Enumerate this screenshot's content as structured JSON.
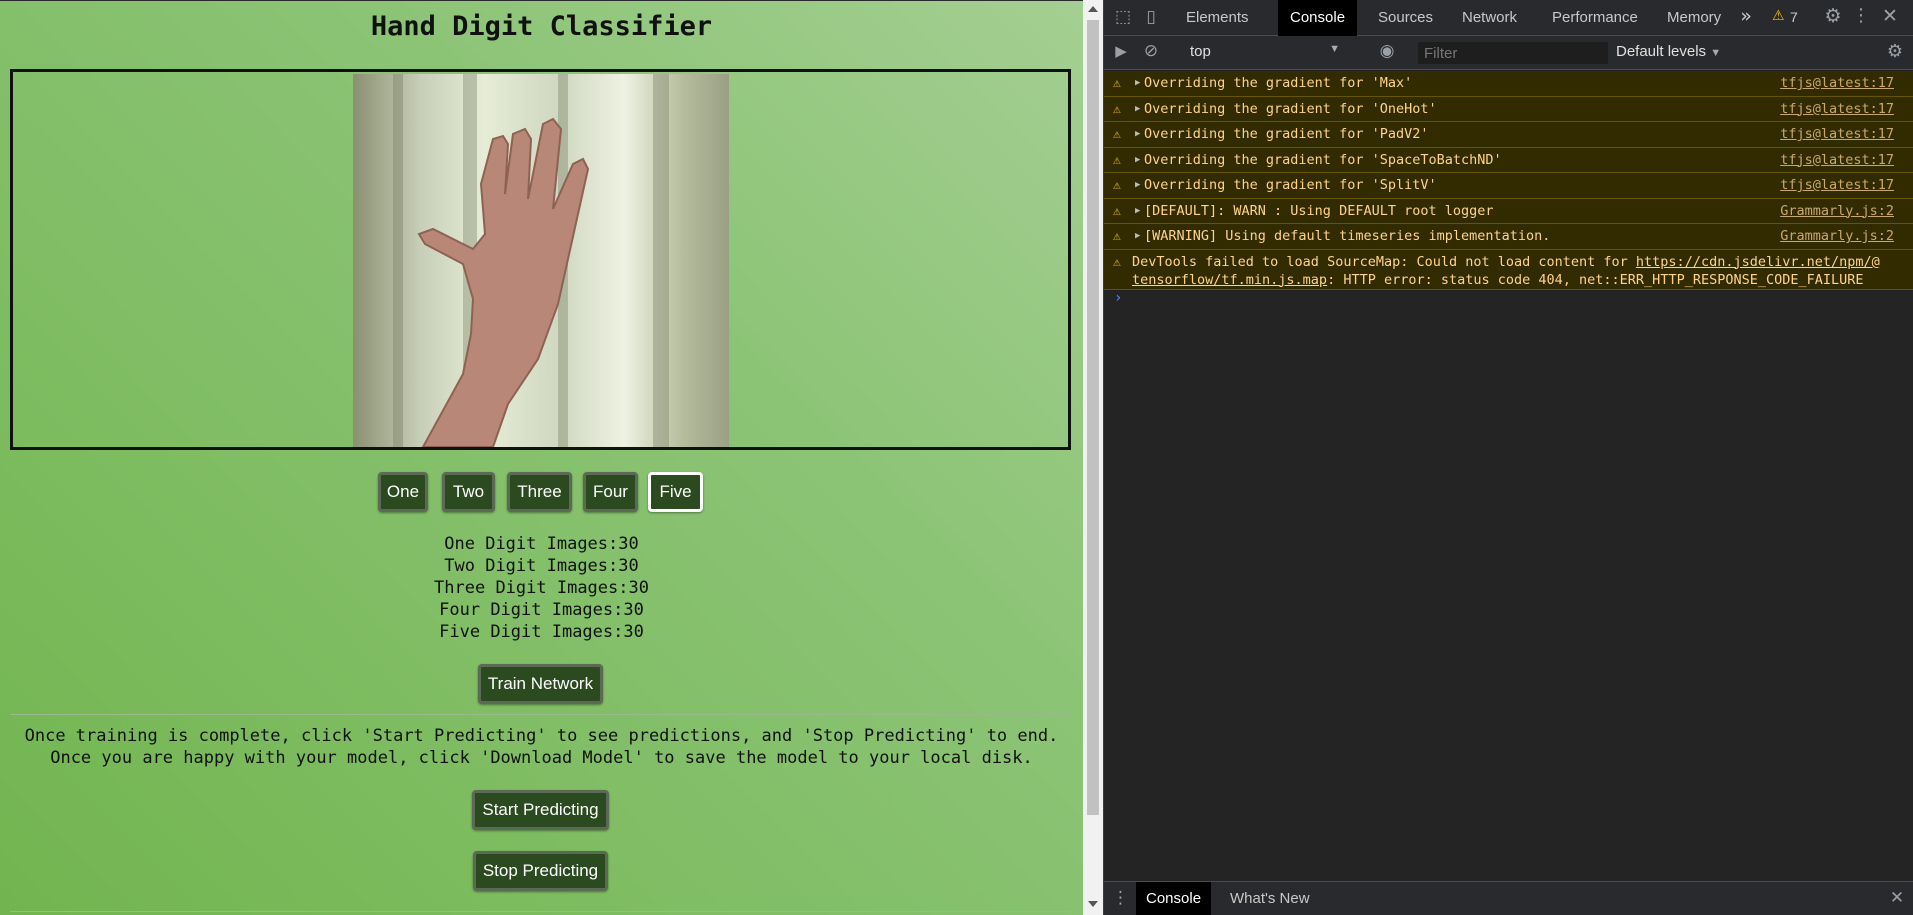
{
  "page": {
    "title": "Hand Digit Classifier",
    "digit_buttons": [
      {
        "label": "One"
      },
      {
        "label": "Two"
      },
      {
        "label": "Three"
      },
      {
        "label": "Four"
      },
      {
        "label": "Five",
        "active": true
      }
    ],
    "counts": [
      "One Digit Images:30",
      "Two Digit Images:30",
      "Three Digit Images:30",
      "Four Digit Images:30",
      "Five Digit Images:30"
    ],
    "train_label": "Train Network",
    "instructions": [
      "Once training is complete, click 'Start Predicting' to see predictions, and 'Stop Predicting' to end.",
      "Once you are happy with your model, click 'Download Model' to save the model to your local disk."
    ],
    "start_label": "Start Predicting",
    "stop_label": "Stop Predicting"
  },
  "devtools": {
    "tabs": [
      "Elements",
      "Console",
      "Sources",
      "Network",
      "Performance",
      "Memory"
    ],
    "active_tab": "Console",
    "more_tabs": "»",
    "warning_count": "7",
    "context": "top",
    "filter_placeholder": "Filter",
    "levels": "Default levels",
    "logs": [
      {
        "msg": "Overriding the gradient for 'Max'",
        "src": "tfjs@latest:17"
      },
      {
        "msg": "Overriding the gradient for 'OneHot'",
        "src": "tfjs@latest:17"
      },
      {
        "msg": "Overriding the gradient for 'PadV2'",
        "src": "tfjs@latest:17"
      },
      {
        "msg": "Overriding the gradient for 'SpaceToBatchND'",
        "src": "tfjs@latest:17"
      },
      {
        "msg": "Overriding the gradient for 'SplitV'",
        "src": "tfjs@latest:17"
      },
      {
        "msg": "[DEFAULT]: WARN : Using DEFAULT root logger",
        "src": "Grammarly.js:2"
      },
      {
        "msg": "[WARNING] Using default timeseries implementation.",
        "src": "Grammarly.js:2"
      }
    ],
    "sourcemap_error": {
      "prefix": "DevTools failed to load SourceMap: Could not load content for ",
      "url_part1": "https://cdn.jsdelivr.net/npm/@",
      "url_part2": "tensorflow/tf.min.js.map",
      "suffix": ": HTTP error: status code 404, net::ERR_HTTP_RESPONSE_CODE_FAILURE"
    },
    "prompt": "›",
    "drawer_tabs": [
      "Console",
      "What's New"
    ],
    "colors": {
      "warning_bg": "#332b00",
      "warning_text": "#ffd48a",
      "warning_icon": "#f5bf00"
    }
  }
}
